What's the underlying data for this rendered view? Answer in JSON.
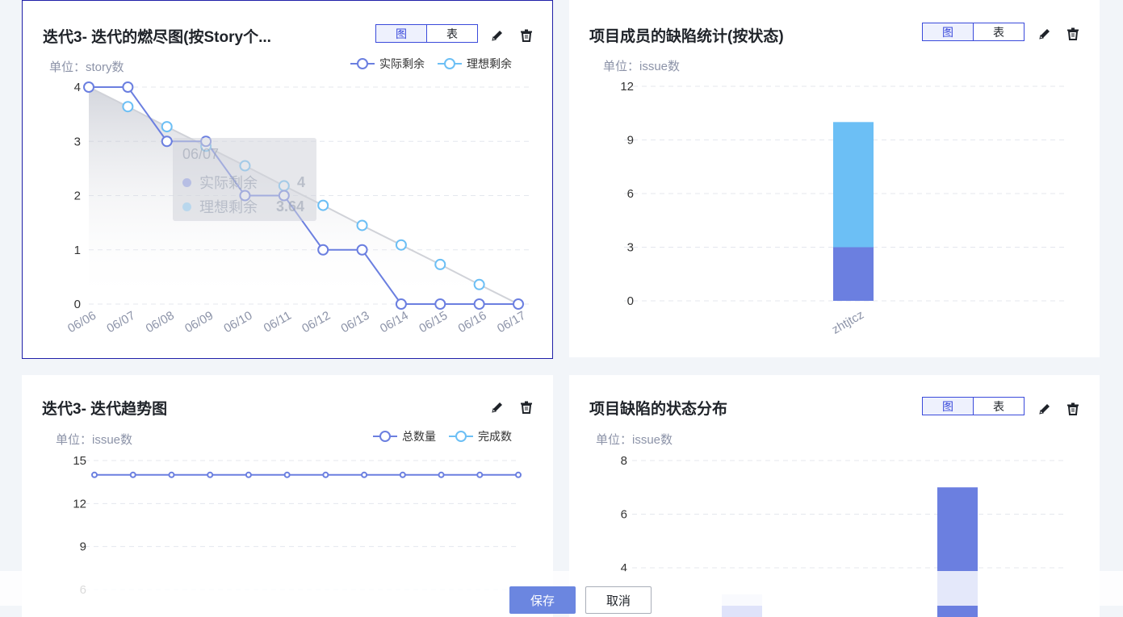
{
  "cards": [
    {
      "title": "迭代3- 迭代的燃尽图(按Story个...",
      "toggle": {
        "chart_label": "图",
        "table_label": "表"
      },
      "unit": "单位：story数",
      "legend": [
        {
          "name": "实际剩余",
          "color": "#6b7fe0"
        },
        {
          "name": "理想剩余",
          "color": "#6cbff5"
        }
      ],
      "tooltip": {
        "date": "06/07",
        "actual_label": "实际剩余",
        "actual_value": "4",
        "ideal_label": "理想剩余",
        "ideal_value": "3.64"
      }
    },
    {
      "title": "项目成员的缺陷统计(按状态)",
      "toggle": {
        "chart_label": "图",
        "table_label": "表"
      },
      "unit": "单位：issue数"
    },
    {
      "title": "迭代3- 迭代趋势图",
      "unit": "单位：issue数",
      "legend": [
        {
          "name": "总数量",
          "color": "#6b7fe0"
        },
        {
          "name": "完成数",
          "color": "#6cbff5"
        }
      ]
    },
    {
      "title": "项目缺陷的状态分布",
      "toggle": {
        "chart_label": "图",
        "table_label": "表"
      },
      "unit": "单位：issue数"
    }
  ],
  "footer": {
    "save_label": "保存",
    "cancel_label": "取消"
  },
  "chart_data": [
    {
      "type": "line",
      "x": [
        "06/06",
        "06/07",
        "06/08",
        "06/09",
        "06/10",
        "06/11",
        "06/12",
        "06/13",
        "06/14",
        "06/15",
        "06/16",
        "06/17"
      ],
      "series": [
        {
          "name": "实际剩余",
          "values": [
            4,
            4,
            3,
            3,
            2,
            2,
            1,
            1,
            0,
            0,
            0,
            0
          ]
        },
        {
          "name": "理想剩余",
          "values": [
            4,
            3.64,
            3.27,
            2.91,
            2.55,
            2.18,
            1.82,
            1.45,
            1.09,
            0.73,
            0.36,
            0
          ]
        }
      ],
      "yticks": [
        "0",
        "1",
        "2",
        "3",
        "4"
      ],
      "ylim": [
        0,
        4
      ]
    },
    {
      "type": "bar",
      "stacked": true,
      "categories": [
        "zhtjtcz"
      ],
      "series": [
        {
          "values": [
            3
          ],
          "color": "#6b7fe0"
        },
        {
          "values": [
            7
          ],
          "color": "#6cbff5"
        }
      ],
      "yticks": [
        "0",
        "3",
        "6",
        "9",
        "12"
      ],
      "ylim": [
        0,
        12
      ]
    },
    {
      "type": "line",
      "series": [
        {
          "name": "总数量",
          "values": [
            14,
            14,
            14,
            14,
            14,
            14,
            14,
            14,
            14,
            14,
            14,
            14
          ]
        }
      ],
      "yticks": [
        "6",
        "9",
        "12",
        "15"
      ],
      "ylim": [
        6,
        15
      ]
    },
    {
      "type": "bar",
      "series": [
        {
          "values": [
            7
          ],
          "color": "#6b7fe0"
        }
      ],
      "yticks": [
        "4",
        "6",
        "8"
      ],
      "ylim": [
        4,
        8
      ]
    }
  ]
}
